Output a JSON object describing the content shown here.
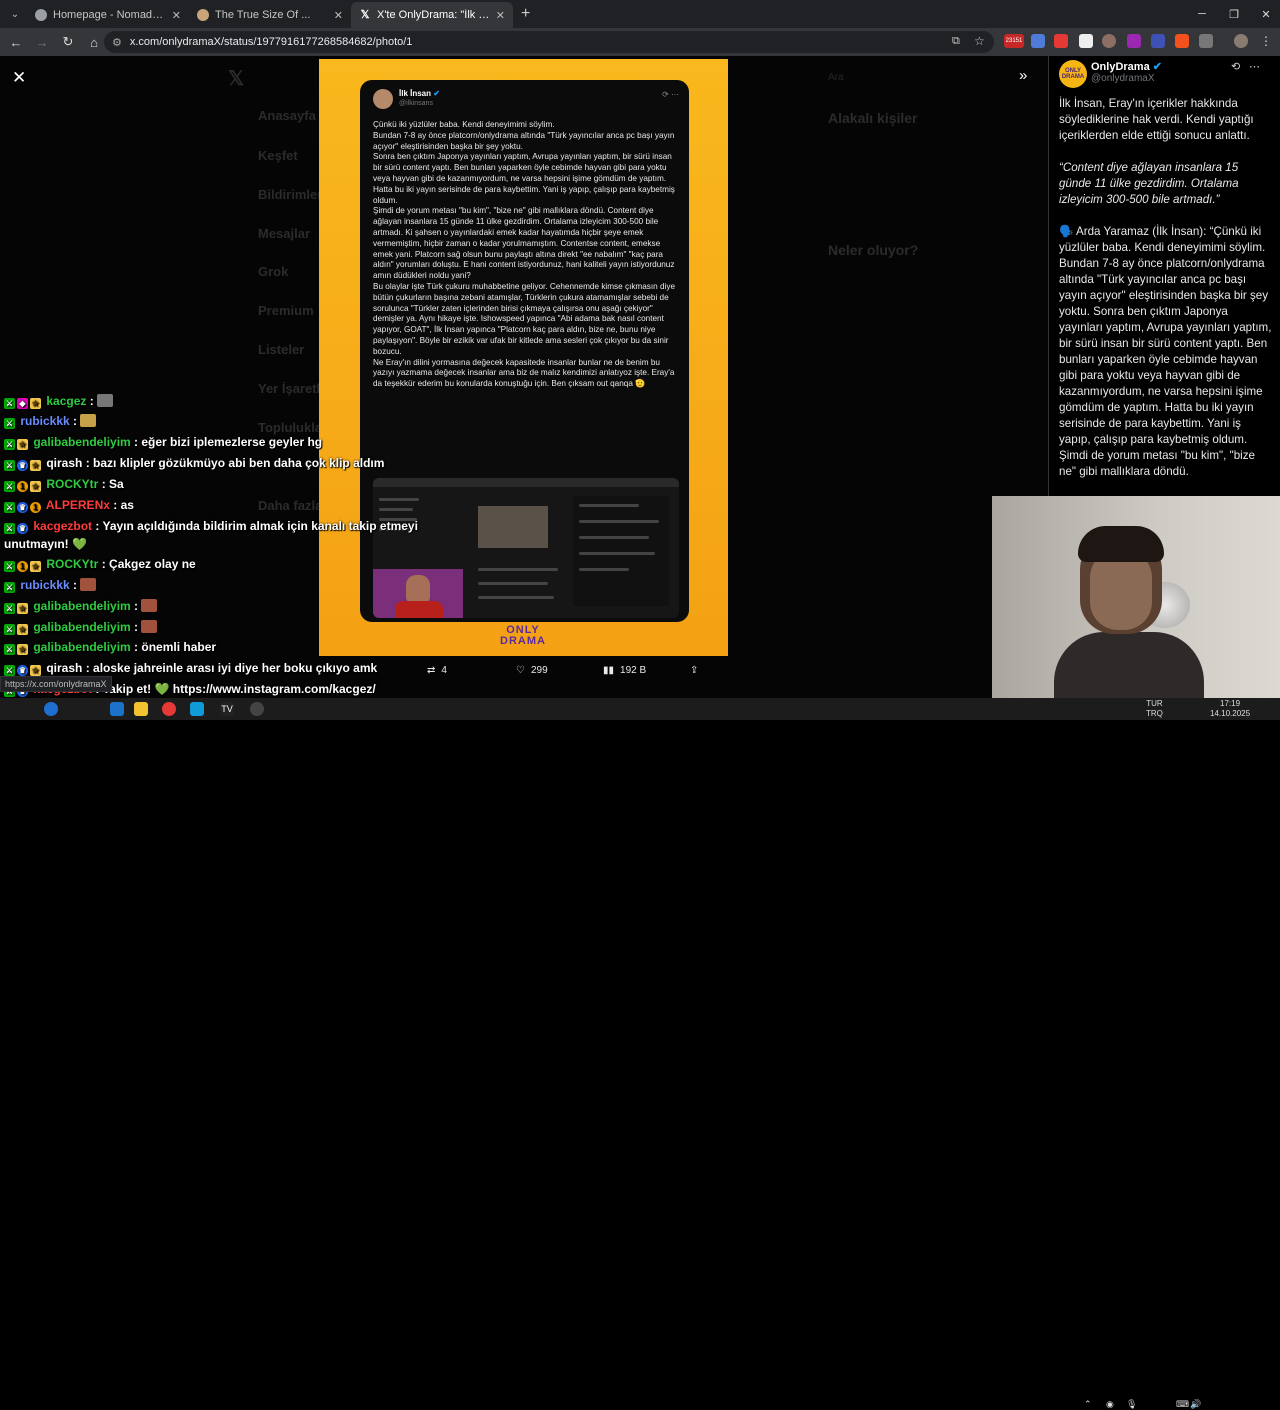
{
  "browser": {
    "tabs": [
      {
        "title": "Homepage - NomadMania",
        "active": false
      },
      {
        "title": "The True Size Of ...",
        "active": false
      },
      {
        "title": "X'te OnlyDrama: \"İlk İnsan, Eray'ın",
        "active": true
      }
    ],
    "url": "x.com/onlydramaX/status/1977916177268584682/photo/1",
    "notif_count": "23151"
  },
  "tweet_image": {
    "author_name": "İlk İnsan",
    "author_handle": "@ilkinsans",
    "body": [
      "Çünkü iki yüzlüler baba. Kendi deneyimimi söylim.",
      "Bundan 7-8 ay önce platcorn/onlydrama altında \"Türk yayıncılar anca pc başı yayın açıyor\" eleştirisinden başka bir şey yoktu.",
      "Sonra ben çıktım Japonya yayınları yaptım, Avrupa yayınları yaptım, bir sürü insan bir sürü content yaptı. Ben bunları yaparken öyle cebimde hayvan gibi para yoktu veya hayvan gibi de kazanmıyordum, ne varsa hepsini işime gömdüm de yaptım. Hatta bu iki yayın serisinde de para kaybettim. Yani iş yapıp, çalışıp para kaybetmiş oldum.",
      "Şimdi de yorum metası \"bu kim\", \"bize ne\" gibi mallıklara döndü. Content diye ağlayan insanlara 15 günde 11 ülke gezdirdim. Ortalama izleyicim 300-500 bile artmadı. Ki şahsen o yayınlardaki emek kadar hayatımda hiçbir şeye emek vermemiştim, hiçbir zaman o kadar yorulmamıştım. Contentse content, emekse emek yani. Platcorn sağ olsun bunu paylaştı altına direkt \"ee nabalım\" \"kaç para aldın\" yorumları doluştu. E hani content istiyordunuz, hani kaliteli yayın istiyordunuz amın düdükleri noldu yani?",
      "Bu olaylar işte Türk çukuru muhabbetine geliyor. Cehennemde kimse çıkmasın diye bütün çukurların başına zebani atamışlar, Türklerin çukura atamamışlar sebebi de sorulunca \"Türkler zaten içlerinden birisi çıkmaya çalışırsa onu aşağı çekiyor\" demişler ya. Aynı hikaye işte. Ishowspeed yapınca \"Abi adama bak nasıl content yapıyor, GOAT\", İlk İnsan yapınca \"Platcorn kaç para aldın, bize ne, bunu niye paylaşıyon\". Böyle bir ezikik var ufak bir kitlede ama sesleri çok çıkıyor bu da sinir bozucu.",
      "Ne Eray'ın dilini yormasına değecek kapasitede insanlar bunlar ne de benim bu yazıyı yazmama değecek insanlar ama biz de malız kendimizi anlatıyoz işte. Eray'a da teşekkür ederim bu konularda konuştuğu için. Ben çıksam out qanqa 🫡"
    ],
    "brand_logo": "ONLY DRAMA"
  },
  "actions": {
    "retweets": "4",
    "likes": "299",
    "views": "192 B"
  },
  "right_panel": {
    "name": "OnlyDrama",
    "handle": "@onlydramaX",
    "paragraphs": [
      "İlk İnsan, Eray'ın içerikler hakkında söylediklerine hak verdi. Kendi yaptığı içeriklerden elde ettiği sonucu anlattı.",
      "“Content diye ağlayan insanlara 15 günde 11 ülke gezdirdim. Ortalama izleyicim 300-500 bile artmadı.”",
      "🗣️ Arda Yaramaz (İlk İnsan): “Çünkü iki yüzlüler baba. Kendi deneyimimi söylim. Bundan 7-8 ay önce platcorn/onlydrama altında \"Türk yayıncılar anca pc başı yayın açıyor\" eleştirisinden başka bir şey yoktu. Sonra ben çıktım Japonya yayınları yaptım, Avrupa yayınları yaptım, bir sürü insan bir sürü content yaptı. Ben bunları yaparken öyle cebimde hayvan gibi para yoktu veya hayvan gibi de kazanmıyordum, ne varsa hepsini işime gömdüm de yaptım. Hatta bu iki yayın serisinde de para kaybettim. Yani iş yapıp, çalışıp para kaybetmiş oldum.  Şimdi de yorum metası \"bu kim\", \"bize ne\" gibi mallıklara döndü."
    ]
  },
  "chat": [
    {
      "user": "kacgez",
      "color": "#2ecc40",
      "text": ""
    },
    {
      "user": "rubickkk",
      "color": "#6a8cff",
      "text": ""
    },
    {
      "user": "galibabendeliyim",
      "color": "#2ecc40",
      "text": "eğer bizi iplemezlerse geyler hg"
    },
    {
      "user": "qirash",
      "color": "#ffffff",
      "text": "bazı klipler gözükmüyo abi ben daha çok klip aldım"
    },
    {
      "user": "ROCKYtr",
      "color": "#2ecc40",
      "text": "Sa"
    },
    {
      "user": "ALPERENx",
      "color": "#ff3b3b",
      "text": "as"
    },
    {
      "user": "kacgezbot",
      "color": "#ff3b3b",
      "text": "Yayın açıldığında bildirim almak için kanalı takip etmeyi"
    },
    {
      "user": "",
      "color": "#ffffff",
      "text": "unutmayın! 💚"
    },
    {
      "user": "ROCKYtr",
      "color": "#2ecc40",
      "text": "Çakgez olay ne"
    },
    {
      "user": "rubickkk",
      "color": "#6a8cff",
      "text": ""
    },
    {
      "user": "galibabendeliyim",
      "color": "#2ecc40",
      "text": ""
    },
    {
      "user": "galibabendeliyim",
      "color": "#2ecc40",
      "text": ""
    },
    {
      "user": "galibabendeliyim",
      "color": "#2ecc40",
      "text": "önemli haber"
    },
    {
      "user": "qirash",
      "color": "#ffffff",
      "text": "aloske jahreinle arası iyi diye her boku çıkıyo amk"
    },
    {
      "user": "kacgezbot",
      "color": "#ff3b3b",
      "text": "Takip et! 💚 https://www.instagram.com/kacgez/"
    },
    {
      "user": "galibabendeliyim",
      "color": "#2ecc40",
      "text": ""
    }
  ],
  "status_url": "https://x.com/onlydramaX",
  "tray": {
    "lang_top": "TUR",
    "lang_bottom": "TRQ",
    "time": "17:19",
    "date": "14.10.2025"
  },
  "dim_sidebar": [
    "Anasayfa",
    "Keşfet",
    "Bildirimler",
    "Mesajlar",
    "Grok",
    "Premium",
    "Listeler",
    "Yer İşaretleri",
    "Topluluklar",
    "Daha fazla"
  ],
  "dim_right": {
    "heading1": "Alakalı kişiler",
    "heading2": "Neler oluyor?",
    "search": "Ara"
  },
  "colors": {
    "accent": "#1d9bf0",
    "photo_bg": "#f6ad18",
    "brand": "#5b2aa0"
  }
}
